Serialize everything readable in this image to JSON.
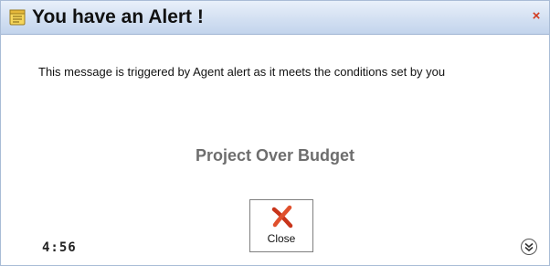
{
  "window": {
    "title": "You have an Alert !",
    "close_glyph": "×",
    "title_icon": "alert-note-icon"
  },
  "body": {
    "message": "This message is triggered by Agent alert as it meets the conditions set by you",
    "subject": "Project Over Budget"
  },
  "close_button": {
    "label": "Close",
    "icon": "red-x-icon"
  },
  "footer": {
    "timer": "4:56",
    "toggle_icon": "double-chevron-down-icon"
  },
  "colors": {
    "title_bar": "#d3e0f2",
    "close_accent": "#d23a1e",
    "subject_text": "#6e6e6e"
  }
}
